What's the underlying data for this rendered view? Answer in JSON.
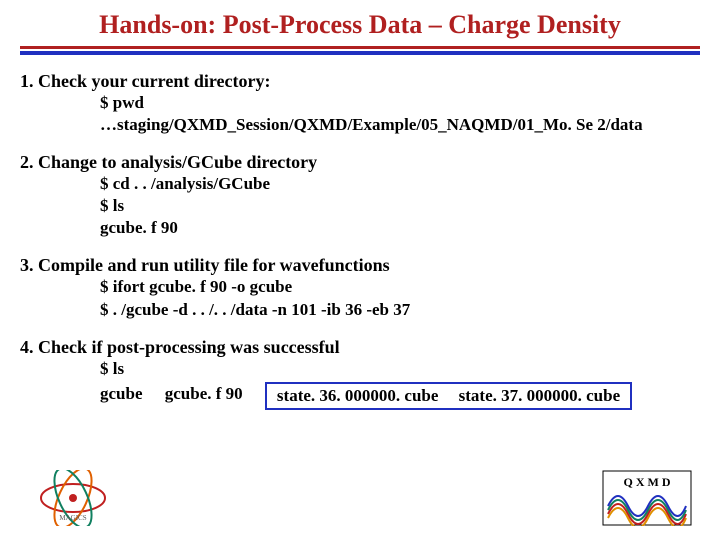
{
  "title": "Hands-on: Post-Process Data – Charge Density",
  "steps": [
    {
      "head": "1. Check your current directory:",
      "code": [
        "$ pwd",
        "…staging/QXMD_Session/QXMD/Example/05_NAQMD/01_Mo. Se 2/data"
      ]
    },
    {
      "head": "2. Change to analysis/GCube directory",
      "code": [
        "$ cd . . /analysis/GCube",
        "$ ls",
        "gcube. f 90"
      ]
    },
    {
      "head": "3. Compile and run utility file for wavefunctions",
      "code": [
        "$ ifort gcube. f 90 -o gcube",
        "$ . /gcube -d . . /. . /data -n 101 -ib 36 -eb 37"
      ]
    },
    {
      "head": "4. Check if post-processing was successful",
      "code": [
        "$ ls"
      ],
      "output": {
        "plain": [
          "gcube",
          "gcube. f 90"
        ],
        "boxed": [
          "state. 36. 000000. cube",
          "state. 37. 000000. cube"
        ]
      }
    }
  ],
  "logos": {
    "left_alt": "MAGICS logo",
    "right_alt": "QXMD logo"
  },
  "colors": {
    "accent_red": "#b02020",
    "accent_blue": "#2030c0"
  }
}
